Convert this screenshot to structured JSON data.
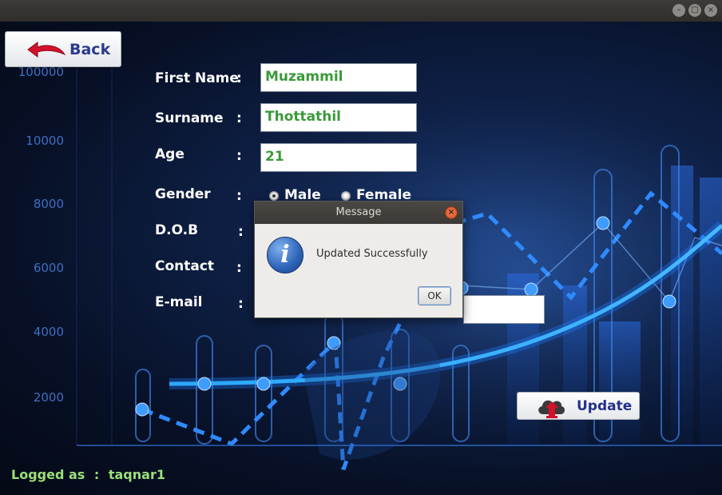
{
  "window": {
    "minimize_glyph": "–",
    "maximize_glyph": "□",
    "close_glyph": "×"
  },
  "back_button": {
    "label": "Back",
    "icon": "red-curved-left-arrow-icon"
  },
  "form": {
    "first_name": {
      "label": "First Name",
      "colon": ":",
      "value": "Muzammil"
    },
    "surname": {
      "label": "Surname",
      "colon": ":",
      "value": "Thottathil"
    },
    "age": {
      "label": "Age",
      "colon": ":",
      "value": "21"
    },
    "gender": {
      "label": "Gender",
      "colon": ":",
      "options": [
        "Male",
        "Female"
      ],
      "selected": "Male"
    },
    "dob": {
      "label": "D.O.B",
      "colon": ":"
    },
    "contact": {
      "label": "Contact",
      "colon": ":"
    },
    "email": {
      "label": "E-mail",
      "colon": ":"
    }
  },
  "update_button": {
    "label": "Update",
    "icon": "cloud-upload-icon"
  },
  "status": {
    "logged_prefix": "Logged as",
    "colon": ":",
    "username": "taqnar1"
  },
  "background_axis": {
    "ticks": [
      "100000",
      "10000",
      "8000",
      "6000",
      "4000",
      "2000"
    ]
  },
  "dialog": {
    "title": "Message",
    "close_glyph": "×",
    "icon": "info-icon",
    "icon_glyph": "i",
    "message": "Updated Successfully",
    "ok_label": "OK"
  },
  "colors": {
    "field_text": "#3a9a3a",
    "label_text": "#ffffff",
    "status_text": "#9be07a",
    "accent_glow": "#2f8bff",
    "button_text": "#24318a"
  }
}
